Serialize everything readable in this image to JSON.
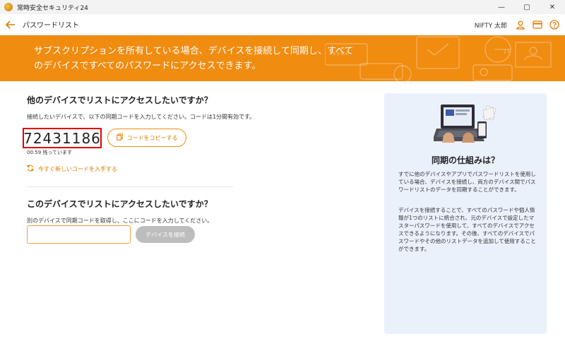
{
  "window": {
    "app_title": "常時安全セキュリティ24",
    "minimize": "—",
    "maximize": "▢",
    "close": "✕"
  },
  "header": {
    "page_title": "パスワードリスト",
    "user_name": "NIFTY 太郎"
  },
  "banner": {
    "text": "サブスクリプションを所有している場合、デバイスを接続して同期し、すべてのデバイスですべてのパスワードにアクセスできます。"
  },
  "other_device": {
    "title": "他のデバイスでリストにアクセスしたいですか？",
    "instruction": "接続したいデバイスで、以下の同期コードを入力してください。コードは1分間有効です。",
    "sync_code": "72431186",
    "copy_button": "コードをコピーする",
    "remaining": "00:59 残っています",
    "new_code_link": "今すぐ新しいコードを入手する"
  },
  "this_device": {
    "title": "このデバイスでリストにアクセスしたいですか？",
    "instruction": "別のデバイスで同期コードを取得し、ここにコードを入力してください。",
    "input_value": "",
    "connect_button": "デバイスを接続"
  },
  "sync_info": {
    "title": "同期の仕組みは？",
    "para1": "すでに他のデバイスやアプリでパスワードリストを使用している場合、デバイスを接続し、両方のデバイス間でパスワードリストのデータを同期することができます。",
    "para2": "デバイスを接続することで、すべてのパスワードや個人情報が1つのリストに統合され、元のデバイスで設定したマスターパスワードを使用して、すべてのデバイスでアクセスできるようになります。その後、すべてのデバイスでパスワードやその他のリストデータを追加して使用することができます。"
  },
  "colors": {
    "accent": "#f08c10",
    "highlight_border": "#e00000",
    "panel_bg": "#eaf1fb"
  }
}
